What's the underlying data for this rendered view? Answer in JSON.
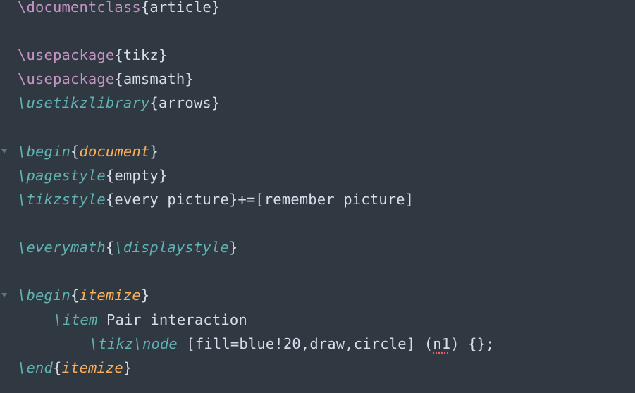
{
  "editor": {
    "lines": {
      "l1": {
        "cmd": "\\documentclass",
        "arg": "article"
      },
      "l3": {
        "cmd": "\\usepackage",
        "arg": "tikz"
      },
      "l4": {
        "cmd": "\\usepackage",
        "arg": "amsmath"
      },
      "l5": {
        "cmd": "\\usetikzlibrary",
        "arg": "arrows"
      },
      "l7": {
        "cmd": "\\begin",
        "arg": "document"
      },
      "l8": {
        "cmd": "\\pagestyle",
        "arg": "empty"
      },
      "l9": {
        "cmd": "\\tikzstyle",
        "arg": "every picture",
        "rest": "+=[remember picture]"
      },
      "l11": {
        "cmd": "\\everymath",
        "inner_cmd": "\\displaystyle"
      },
      "l13": {
        "cmd": "\\begin",
        "arg": "itemize"
      },
      "l14": {
        "cmd": "\\item",
        "text": " Pair interaction"
      },
      "l15": {
        "cmd1": "\\tikz",
        "cmd2": "\\node",
        "opts": " [fill=blue!20,draw,circle] (",
        "name": "n1",
        "rest": ") {};"
      },
      "l16": {
        "cmd": "\\end",
        "arg": "itemize"
      }
    },
    "syntax_colors": {
      "background": "#303841",
      "command": "#c594c5",
      "command_italic": "#5fb3b3",
      "environment": "#f9ae58",
      "text": "#d8dee9",
      "error_underline": "#ec5f66"
    }
  }
}
